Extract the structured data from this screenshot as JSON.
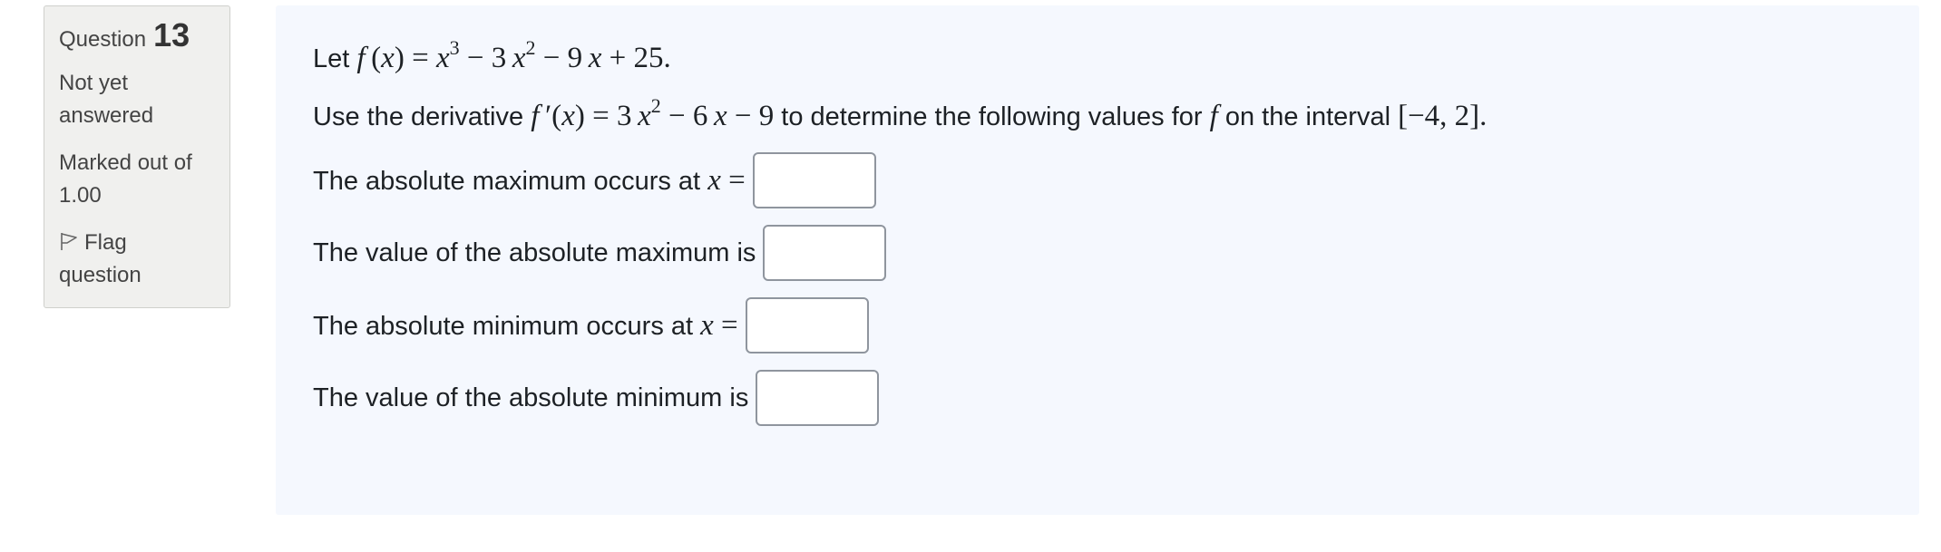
{
  "question_info": {
    "label": "Question",
    "number": "13",
    "state": "Not yet answered",
    "grade": "Marked out of 1.00",
    "flag_label": "Flag question",
    "flag_icon": "flag-outline-icon"
  },
  "question": {
    "intro_prefix": "Let",
    "function_def": "f (x) = x³ − 3 x² − 9 x + 25.",
    "derivative_prefix": "Use the derivative",
    "derivative_def": "f ′(x) = 3 x² − 6 x − 9",
    "derivative_suffix_1": "to determine the following values for",
    "function_name": "f",
    "derivative_suffix_2": "on the interval",
    "interval": "[−4, 2]."
  },
  "answers": [
    {
      "label": "The absolute maximum occurs at",
      "math": "x =",
      "value": ""
    },
    {
      "label": "The value of the absolute maximum is",
      "math": "",
      "value": ""
    },
    {
      "label": "The absolute minimum occurs at",
      "math": "x =",
      "value": ""
    },
    {
      "label": "The value of the absolute minimum is",
      "math": "",
      "value": ""
    }
  ]
}
